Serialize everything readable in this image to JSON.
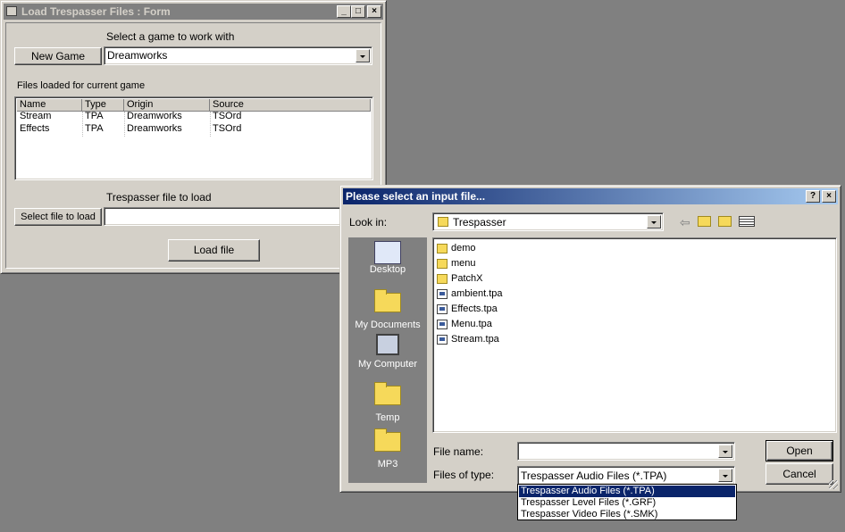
{
  "form": {
    "title": "Load Trespasser Files : Form",
    "select_game_label": "Select a game to work with",
    "new_game_button": "New Game",
    "game_value": "Dreamworks",
    "files_loaded_label": "Files loaded for current game",
    "columns": [
      "Name",
      "Type",
      "Origin",
      "Source"
    ],
    "rows": [
      [
        "Stream",
        "TPA",
        "Dreamworks",
        "TSOrd"
      ],
      [
        "Effects",
        "TPA",
        "Dreamworks",
        "TSOrd"
      ]
    ],
    "file_to_load_label": "Trespasser file to load",
    "select_file_button": "Select file to load",
    "file_to_load_value": "",
    "load_file_button": "Load file"
  },
  "dialog": {
    "title": "Please select an input file...",
    "look_in_label": "Look in:",
    "look_in_value": "Trespasser",
    "places": [
      "Desktop",
      "My Documents",
      "My Computer",
      "Temp",
      "MP3"
    ],
    "files": [
      {
        "name": "demo",
        "kind": "folder"
      },
      {
        "name": "menu",
        "kind": "folder"
      },
      {
        "name": "PatchX",
        "kind": "folder"
      },
      {
        "name": "ambient.tpa",
        "kind": "file"
      },
      {
        "name": "Effects.tpa",
        "kind": "file"
      },
      {
        "name": "Menu.tpa",
        "kind": "file"
      },
      {
        "name": "Stream.tpa",
        "kind": "file"
      }
    ],
    "file_name_label": "File name:",
    "file_name_value": "",
    "files_of_type_label": "Files of type:",
    "files_of_type_value": "Trespasser Audio Files (*.TPA)",
    "type_options": [
      "Trespasser Audio Files (*.TPA)",
      "Trespasser Level Files (*.GRF)",
      "Trespasser Video Files (*.SMK)"
    ],
    "open_button": "Open",
    "cancel_button": "Cancel"
  }
}
